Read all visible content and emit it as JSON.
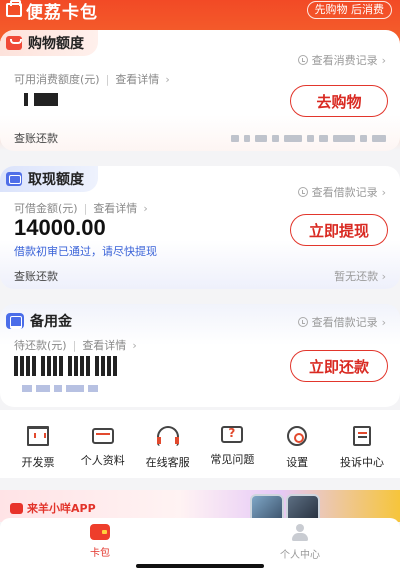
{
  "header": {
    "brand_label": "便荔卡包",
    "pill_label": "先购物 后消费"
  },
  "shopping_card": {
    "title": "购物额度",
    "record_link": "查看消费记录",
    "available_label": "可用消费额度(元)",
    "detail_link": "查看详情",
    "amount_display": "masked",
    "action_label": "去购物",
    "bottom_left": "查账还款"
  },
  "cash_card": {
    "title": "取现额度",
    "record_link": "查看借款记录",
    "available_label": "可借金额(元)",
    "detail_link": "查看详情",
    "amount": "14000.00",
    "notice": "借款初审已通过，请尽快提现",
    "action_label": "立即提现",
    "bottom_left": "查账还款",
    "bottom_right": "暂无还款"
  },
  "reserve_card": {
    "title": "备用金",
    "record_link": "查看借款记录",
    "pending_label": "待还款(元)",
    "detail_link": "查看详情",
    "action_label": "立即还款"
  },
  "tools": [
    {
      "label": "开发票",
      "icon": "invoice-icon"
    },
    {
      "label": "个人资料",
      "icon": "id-card-icon"
    },
    {
      "label": "在线客服",
      "icon": "headset-icon"
    },
    {
      "label": "常见问题",
      "icon": "faq-icon"
    },
    {
      "label": "设置",
      "icon": "gear-icon"
    },
    {
      "label": "投诉中心",
      "icon": "complaint-icon"
    }
  ],
  "promo": {
    "tag": "来羊小咩APP"
  },
  "nav": {
    "wallet_label": "卡包",
    "profile_label": "个人中心"
  },
  "colors": {
    "brand_red": "#e2332a",
    "link_blue": "#3a63d8"
  }
}
